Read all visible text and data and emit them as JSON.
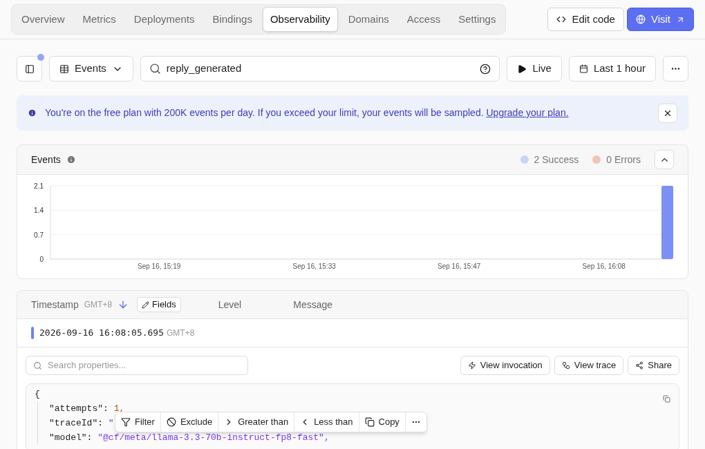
{
  "tabs": [
    {
      "label": "Overview",
      "selected": false
    },
    {
      "label": "Metrics",
      "selected": false
    },
    {
      "label": "Deployments",
      "selected": false
    },
    {
      "label": "Bindings",
      "selected": false
    },
    {
      "label": "Observability",
      "selected": true
    },
    {
      "label": "Domains",
      "selected": false
    },
    {
      "label": "Access",
      "selected": false
    },
    {
      "label": "Settings",
      "selected": false
    }
  ],
  "header_actions": {
    "edit": "Edit code",
    "visit": "Visit"
  },
  "toolbar": {
    "panel_toggle_dot": true,
    "view": "Events",
    "query": "reply_generated",
    "live": "Live",
    "range": "Last 1 hour"
  },
  "notice": {
    "text": "You're on the free plan with 200K events per day. If you exceed your limit, your events will be sampled.",
    "link": "Upgrade your plan."
  },
  "events_panel": {
    "title": "Events",
    "expanded": true,
    "legend": [
      {
        "count": "2",
        "label": "Success",
        "color": "#c9d3f7"
      },
      {
        "count": "0",
        "label": "Errors",
        "color": "#f2c4b3"
      }
    ],
    "chart_data": {
      "type": "bar",
      "categories": [
        null,
        null,
        null,
        null,
        null,
        null,
        null,
        null,
        null,
        null,
        "Sep 16, 15:19",
        null,
        null,
        null,
        null,
        null,
        null,
        null,
        null,
        null,
        null,
        null,
        null,
        null,
        null,
        "Sep 16, 15:33",
        null,
        null,
        null,
        null,
        null,
        null,
        null,
        null,
        null,
        null,
        null,
        null,
        null,
        "Sep 16, 15:47",
        null,
        null,
        null,
        null,
        null,
        null,
        null,
        null,
        null,
        null,
        null,
        null,
        null,
        "Sep 16, 16:08",
        null,
        null,
        null,
        null,
        null,
        null
      ],
      "series": [
        {
          "color": "#7b8ff5",
          "values": [
            0,
            0,
            0,
            0,
            0,
            0,
            0,
            0,
            0,
            0,
            0,
            0,
            0,
            0,
            0,
            0,
            0,
            0,
            0,
            0,
            0,
            0,
            0,
            0,
            0,
            0,
            0,
            0,
            0,
            0,
            0,
            0,
            0,
            0,
            0,
            0,
            0,
            0,
            0,
            0,
            0,
            0,
            0,
            0,
            0,
            0,
            0,
            0,
            0,
            0,
            0,
            0,
            0,
            0,
            0,
            0,
            0,
            0,
            0,
            2.1
          ]
        }
      ],
      "ylim": [
        0,
        2.1
      ],
      "yticks": [
        0,
        0.7,
        1.4,
        2.1
      ]
    }
  },
  "log_table": {
    "columns": {
      "timestamp": "Timestamp",
      "tz": "GMT+8",
      "fields": "Fields",
      "level": "Level",
      "message": "Message"
    },
    "row": {
      "timestamp": "2026-09-16 16:08:05.695",
      "tz": "GMT+8",
      "color": "#6e83f3"
    },
    "search_placeholder": "Search properties...",
    "actions": [
      "View invocation",
      "View trace",
      "Share"
    ],
    "json_lines": [
      {
        "kind": "brace",
        "text": "{"
      },
      {
        "kind": "number",
        "key": "\"attempts\":",
        "value": "1,"
      },
      {
        "kind": "string",
        "key": "\"traceId\":",
        "value": "\""
      },
      {
        "kind": "string",
        "key": "\"model\":",
        "value": "\"@cf/meta/llama-3.3-70b-instruct-fp8-fast\","
      }
    ],
    "popover": [
      "Filter",
      "Exclude",
      "Greater than",
      "Less than",
      "Copy"
    ]
  }
}
